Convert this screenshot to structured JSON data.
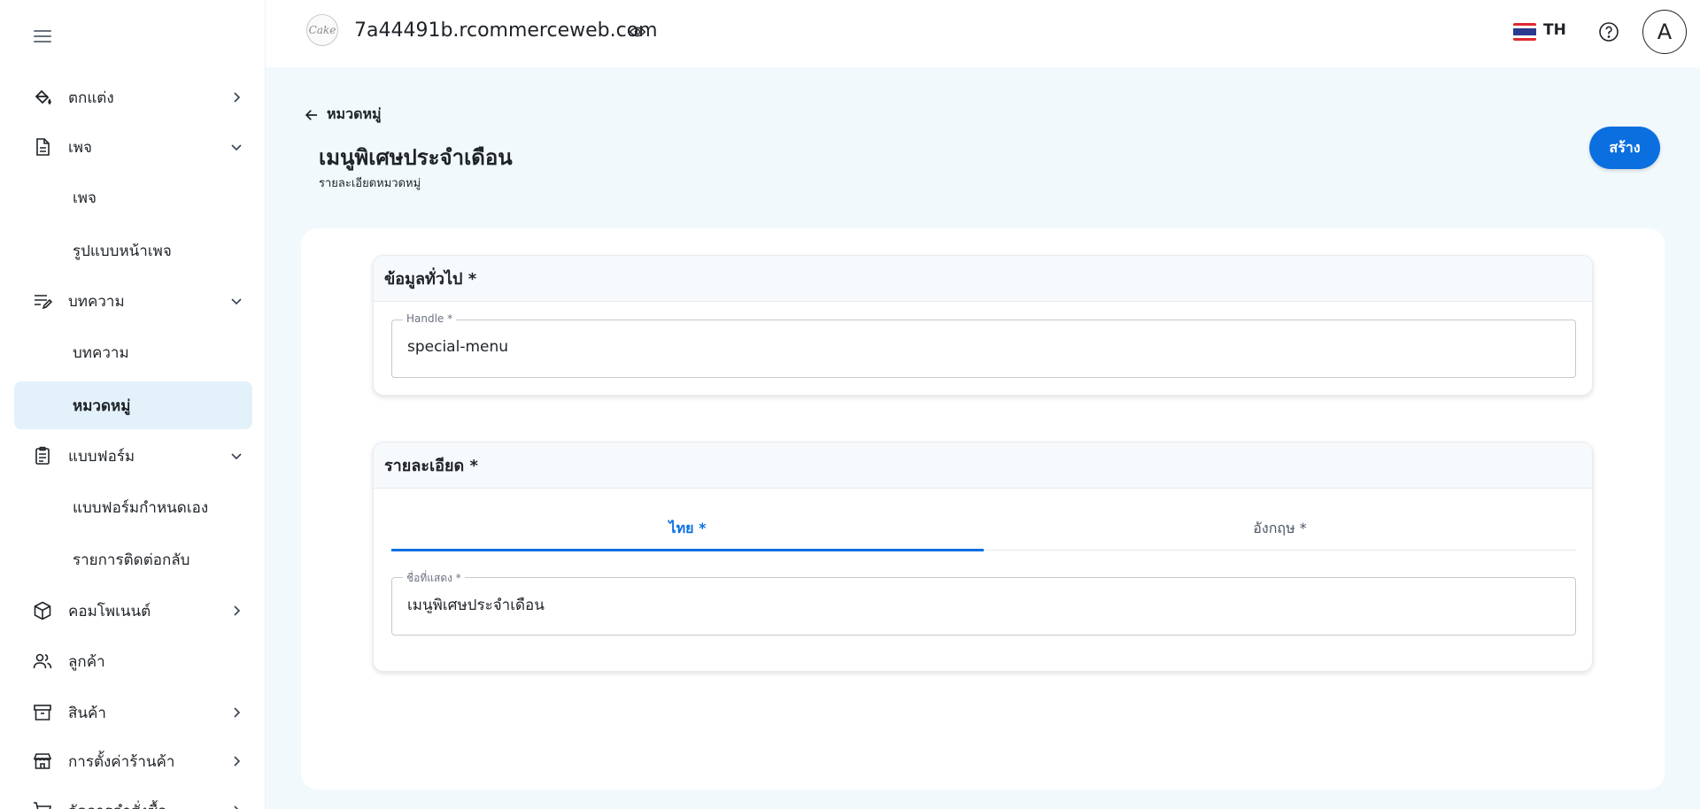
{
  "topbar": {
    "domain": "7a44491b.rcommerceweb.com",
    "language": "TH",
    "avatar_initial": "A",
    "logo_text": "Cake"
  },
  "sidebar": {
    "items": [
      {
        "label": "ตกแต่ง",
        "icon": "paint-bucket-icon",
        "chevron": "right"
      },
      {
        "label": "เพจ",
        "icon": "page-icon",
        "chevron": "down"
      },
      {
        "label": "เพจ",
        "sub": true
      },
      {
        "label": "รูปแบบหน้าเพจ",
        "sub": true
      },
      {
        "label": "บทความ",
        "icon": "article-edit-icon",
        "chevron": "down"
      },
      {
        "label": "บทความ",
        "sub": true
      },
      {
        "label": "หมวดหมู่",
        "sub": true,
        "active": true
      },
      {
        "label": "แบบฟอร์ม",
        "icon": "clipboard-icon",
        "chevron": "down"
      },
      {
        "label": "แบบฟอร์มกำหนดเอง",
        "sub": true
      },
      {
        "label": "รายการติดต่อกลับ",
        "sub": true
      },
      {
        "label": "คอมโพเนนต์",
        "icon": "cube-icon",
        "chevron": "right"
      },
      {
        "label": "ลูกค้า",
        "icon": "users-icon"
      },
      {
        "label": "สินค้า",
        "icon": "archive-box-icon",
        "chevron": "right"
      },
      {
        "label": "การตั้งค่าร้านค้า",
        "icon": "store-icon",
        "chevron": "right"
      },
      {
        "label": "จัดการคำสั่งซื้อ",
        "icon": "cart-icon",
        "chevron": "right"
      }
    ]
  },
  "header": {
    "back_label": "หมวดหมู่",
    "title": "เมนูพิเศษประจำเดือน",
    "subtitle": "รายละเอียดหมวดหมู่",
    "create_label": "สร้าง"
  },
  "general_card": {
    "title": "ข้อมูลทั่วไป *",
    "handle_label": "Handle *",
    "handle_value": "special-menu"
  },
  "details_card": {
    "title": "รายละเอียด *",
    "tabs": [
      {
        "label": "ไทย *",
        "active": true
      },
      {
        "label": "อังกฤษ *",
        "active": false
      }
    ],
    "display_name_label": "ชื่อที่แสดง *",
    "display_name_value": "เมนูพิเศษประจำเดือน"
  },
  "colors": {
    "accent": "#0b6fe0",
    "active_nav_bg": "#e3f1fb",
    "page_bg": "#f1f9fd"
  }
}
